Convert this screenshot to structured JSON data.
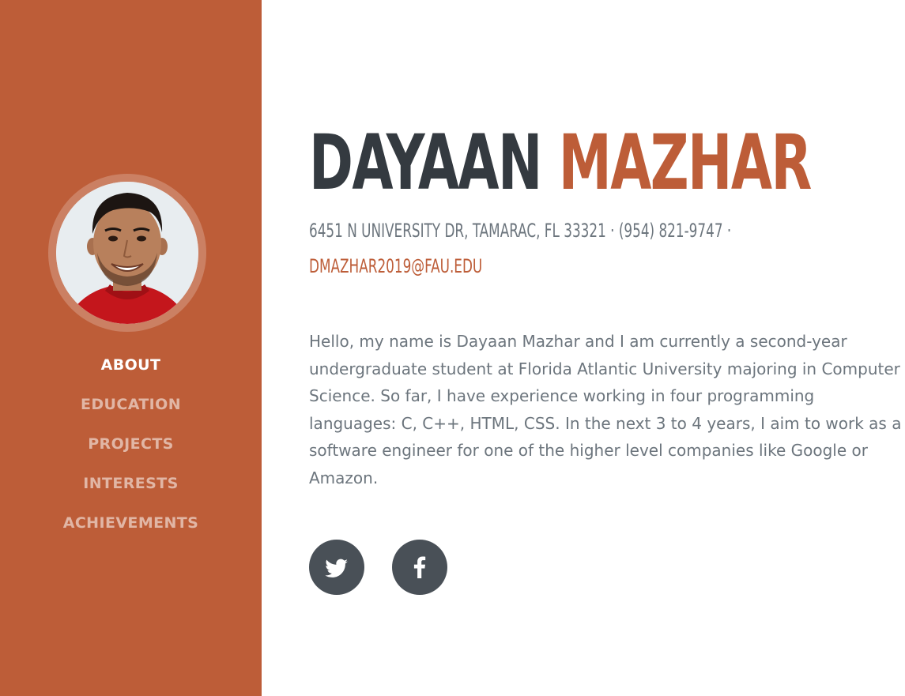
{
  "profile": {
    "first_name": "DAYAAN",
    "last_name": "MAZHAR",
    "address": "6451 N UNIVERSITY DR, TAMARAC, FL 33321 · (954) 821-9747 ·",
    "email": "DMAZHAR2019@FAU.EDU",
    "bio": "Hello, my name is Dayaan Mazhar and I am currently a second-year undergraduate student at Florida Atlantic University majoring in Computer Science. So far, I have experience working in four programming languages: C, C++, HTML, CSS. In the next 3 to 4 years, I aim to work as a software engineer for one of the higher level companies like Google or Amazon."
  },
  "nav": {
    "items": [
      {
        "label": "ABOUT",
        "active": true
      },
      {
        "label": "EDUCATION",
        "active": false
      },
      {
        "label": "PROJECTS",
        "active": false
      },
      {
        "label": "INTERESTS",
        "active": false
      },
      {
        "label": "ACHIEVEMENTS",
        "active": false
      }
    ]
  },
  "social": {
    "icons": [
      "twitter-icon",
      "facebook-icon"
    ]
  },
  "colors": {
    "primary": "#bd5d38",
    "heading": "#343a40",
    "text": "#6c757d",
    "social_bg": "#495057"
  }
}
